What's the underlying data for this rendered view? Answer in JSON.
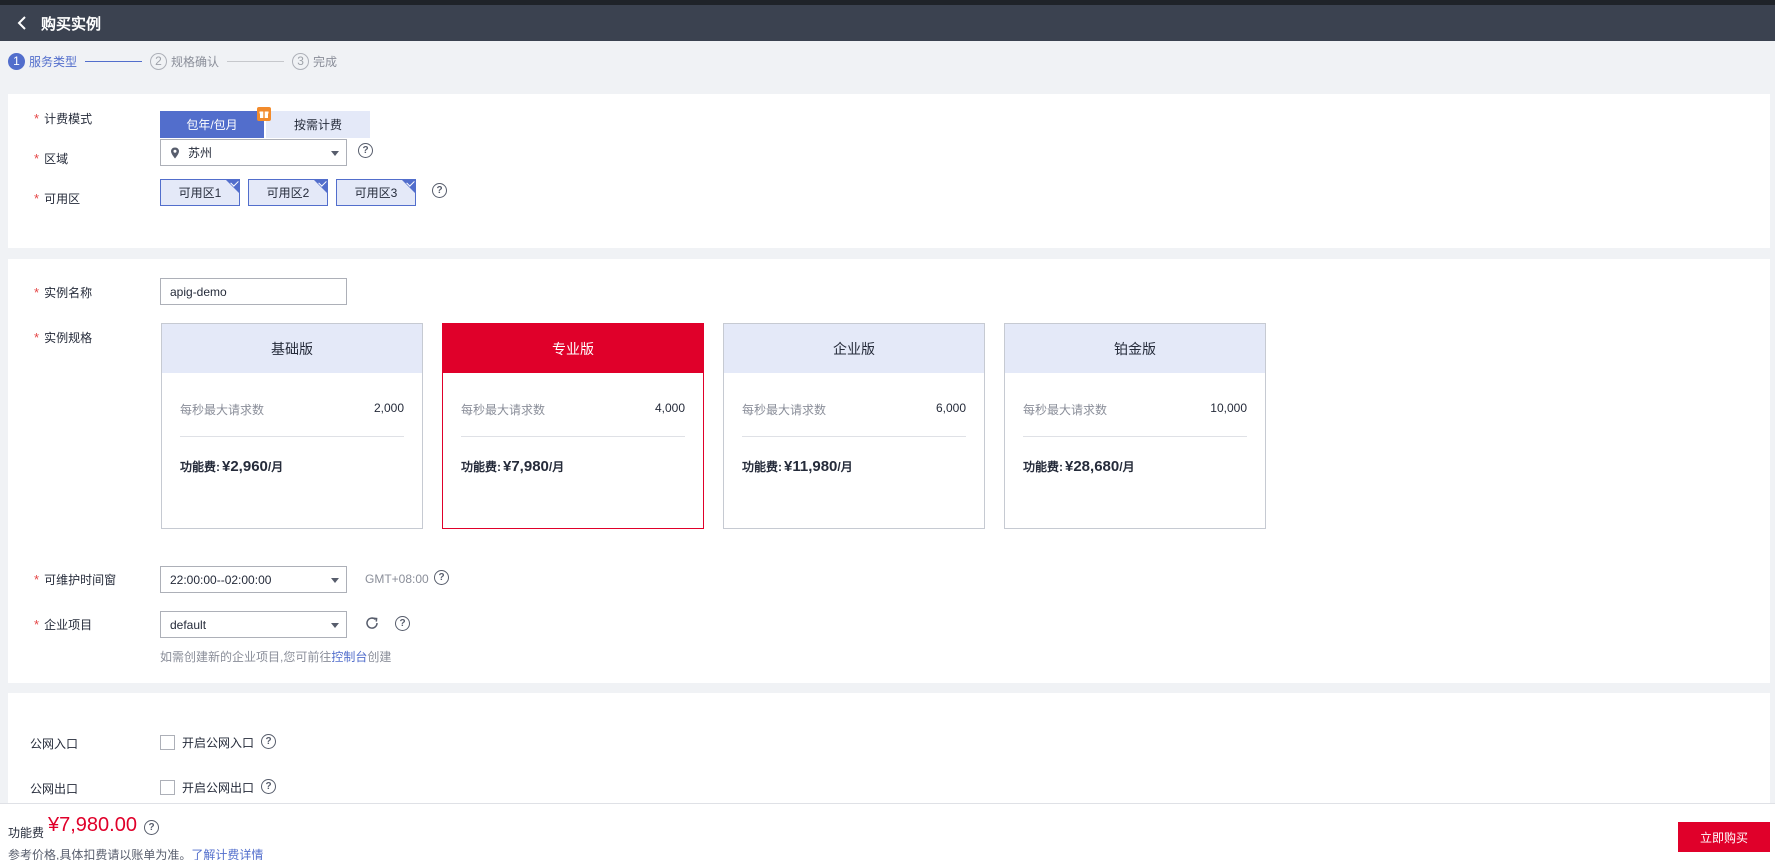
{
  "header": {
    "title": "购买实例"
  },
  "steps": [
    {
      "num": "1",
      "label": "服务类型"
    },
    {
      "num": "2",
      "label": "规格确认"
    },
    {
      "num": "3",
      "label": "完成"
    }
  ],
  "billing": {
    "label": "计费模式",
    "options": [
      "包年/包月",
      "按需计费"
    ],
    "selected": "包年/包月"
  },
  "region": {
    "label": "区域",
    "value": "苏州"
  },
  "az": {
    "label": "可用区",
    "options": [
      "可用区1",
      "可用区2",
      "可用区3"
    ]
  },
  "instance_name": {
    "label": "实例名称",
    "value": "apig-demo"
  },
  "spec": {
    "label": "实例规格",
    "metric_label": "每秒最大请求数",
    "price_label": "功能费:",
    "price_unit": "/月",
    "selected": "专业版",
    "cards": [
      {
        "name": "基础版",
        "metric": "2,000",
        "price": "¥2,960"
      },
      {
        "name": "专业版",
        "metric": "4,000",
        "price": "¥7,980"
      },
      {
        "name": "企业版",
        "metric": "6,000",
        "price": "¥11,980"
      },
      {
        "name": "铂金版",
        "metric": "10,000",
        "price": "¥28,680"
      }
    ]
  },
  "maintenance": {
    "label": "可维护时间窗",
    "value": "22:00:00--02:00:00",
    "timezone": "GMT+08:00"
  },
  "project": {
    "label": "企业项目",
    "value": "default",
    "hint_prefix": "如需创建新的企业项目,您可前往",
    "hint_link": "控制台",
    "hint_suffix": "创建"
  },
  "public_in": {
    "label": "公网入口",
    "checkbox_label": "开启公网入口"
  },
  "public_out": {
    "label": "公网出口",
    "checkbox_label": "开启公网出口"
  },
  "footer": {
    "fee_label": "功能费",
    "fee_value": "¥7,980.00",
    "note_prefix": "参考价格,具体扣费请以账单为准。",
    "note_link": "了解计费详情",
    "buy_label": "立即购买"
  },
  "colors": {
    "primary": "#526ecc",
    "selected_card": "#e0002a",
    "header_bg": "#3b4250"
  }
}
